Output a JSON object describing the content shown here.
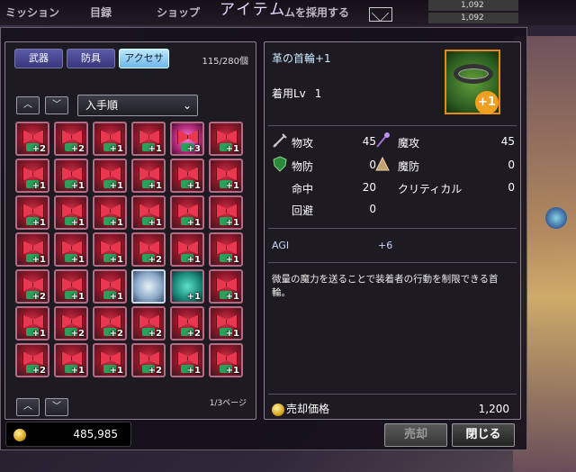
{
  "header": {
    "title": "アイテム",
    "nav": [
      "ミッション",
      "目録",
      "ショップ",
      "ムを採用する"
    ],
    "ticker": [
      "1,092",
      "1,092"
    ]
  },
  "tabs": [
    {
      "label": "武器",
      "active": false
    },
    {
      "label": "防具",
      "active": false
    },
    {
      "label": "アクセサリ",
      "active": true
    }
  ],
  "inventory": {
    "count": "115/280個",
    "sort_label": "入手順",
    "page": "1/3ページ",
    "grid": [
      [
        "+2",
        "+2",
        "+1",
        "+1",
        "+3",
        "+1"
      ],
      [
        "+1",
        "+1",
        "+1",
        "+1",
        "+1",
        "+1"
      ],
      [
        "+1",
        "+1",
        "+1",
        "+1",
        "+1",
        "+1"
      ],
      [
        "+1",
        "+1",
        "+1",
        "+2",
        "+1",
        "+1"
      ],
      [
        "+2",
        "+1",
        "+1",
        "",
        "+1",
        "+1"
      ],
      [
        "+1",
        "+2",
        "+2",
        "+2",
        "+2",
        "+1"
      ],
      [
        "+2",
        "+1",
        "+1",
        "+2",
        "+1",
        "+1"
      ]
    ]
  },
  "detail": {
    "name": "革の首輪+1",
    "equip_label": "着用Lv",
    "equip_value": "1",
    "plus_badge": "+1",
    "stats": [
      {
        "label": "物攻",
        "value": "45",
        "icon": "sword-icon"
      },
      {
        "label": "魔攻",
        "value": "45",
        "icon": "wand-icon"
      },
      {
        "label": "物防",
        "value": "0",
        "icon": "shield-icon"
      },
      {
        "label": "魔防",
        "value": "0",
        "icon": "magic-defense-icon"
      },
      {
        "label": "命中",
        "value": "20"
      },
      {
        "label": "クリティカル",
        "value": "0"
      },
      {
        "label": "回避",
        "value": "0"
      }
    ],
    "bonus_label": "AGI",
    "bonus_value": "+6",
    "description": "微量の魔力を送ることで装着者の行動を制限できる首輪。",
    "sell_label": "売却価格",
    "sell_value": "1,200"
  },
  "footer": {
    "money": "485,985",
    "sell_button": "売却",
    "close_button": "閉じる"
  }
}
